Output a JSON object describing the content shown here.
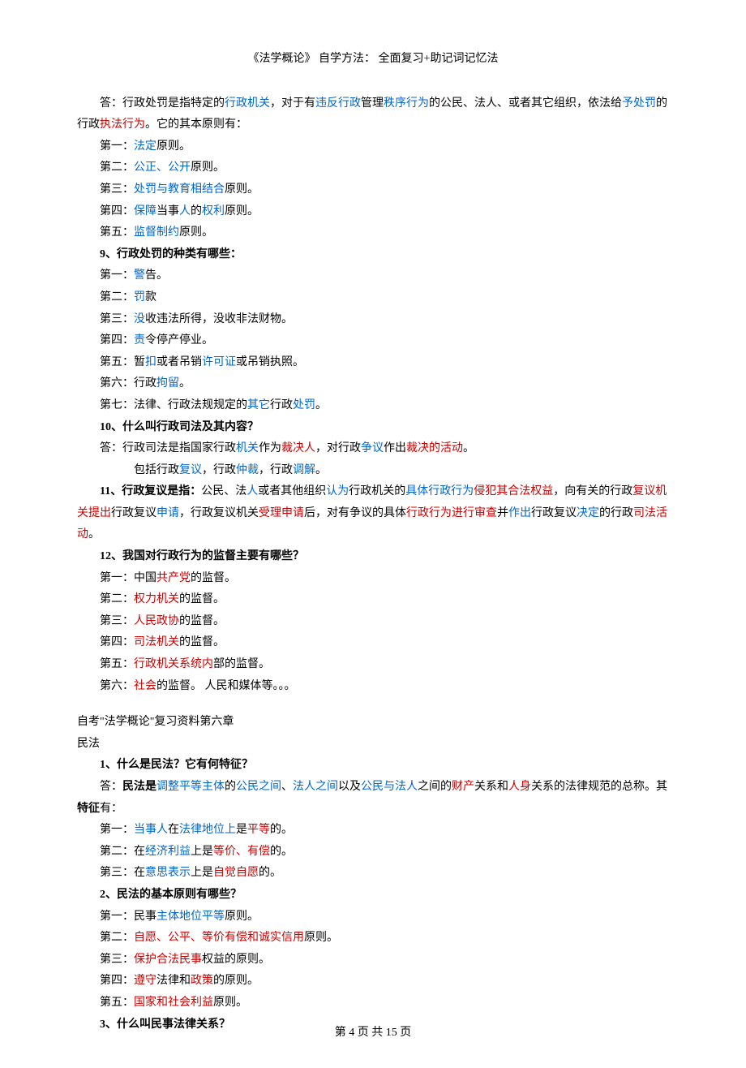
{
  "header": "《法学概论》 自学方法：   全面复习+助记词记忆法",
  "a_intro_p1": "答：行政处罚是指特定的",
  "a_intro_k1": "行政机关",
  "a_intro_p2": "，对于有",
  "a_intro_k2": "违反行政",
  "a_intro_p3": "管理",
  "a_intro_k3": "秩序行为",
  "a_intro_p4": "的公民、法人、或者其它组织，依法给",
  "a_intro_k4": "予处罚",
  "a_intro_p5": "的行政",
  "a_intro_k5": "执法行为",
  "a_intro_p6": "。它的其本原则有：",
  "p1_a": "第一：",
  "p1_b": "法定",
  "p1_c": "原则。",
  "p2_a": "第二：",
  "p2_b": "公正、公开",
  "p2_c": "原则。",
  "p3_a": "第三：",
  "p3_b": "处罚与教育相结合",
  "p3_c": "原则。",
  "p4_a": "第四：",
  "p4_b": "保障",
  "p4_c": "当事",
  "p4_d": "人",
  "p4_e": "的",
  "p4_f": "权利",
  "p4_g": "原则。",
  "p5_a": "第五：",
  "p5_b": "监督制约",
  "p5_c": "原则。",
  "q9": "9、行政处罚的种类有哪些：",
  "q9_1a": "第一：",
  "q9_1b": "警",
  "q9_1c": "告。",
  "q9_2a": "第二：",
  "q9_2b": "罚",
  "q9_2c": "款",
  "q9_3a": "第三：",
  "q9_3b": "没",
  "q9_3c": "收违法所得，没收非法财物。",
  "q9_4a": "第四：",
  "q9_4b": "责",
  "q9_4c": "令停产停业。",
  "q9_5a": "第五：暂",
  "q9_5b": "扣",
  "q9_5c": "或者吊销",
  "q9_5d": "许可证",
  "q9_5e": "或吊销执照。",
  "q9_6a": "第六：行政",
  "q9_6b": "拘留",
  "q9_6c": "。",
  "q9_7a": "第七：法律、行政法规规定的",
  "q9_7b": "其它",
  "q9_7c": "行政",
  "q9_7d": "处罚",
  "q9_7e": "。",
  "q10": "10、什么叫行政司法及其内容？",
  "q10_a1": "答：行政司法是指国家行政",
  "q10_a2": "机关",
  "q10_a3": "作为",
  "q10_a4": "裁决人",
  "q10_a5": "，对行政",
  "q10_a6": "争议",
  "q10_a7": "作出",
  "q10_a8": "裁决的活动",
  "q10_a9": "。",
  "q10_b1": "包括行政",
  "q10_b2": "复议",
  "q10_b3": "，行政",
  "q10_b4": "仲裁",
  "q10_b5": "，行政",
  "q10_b6": "调解",
  "q10_b7": "。",
  "q11a": "11、行政复议是指：",
  "q11b": "公民、法",
  "q11c": "人",
  "q11d": "或者其他组织",
  "q11e": "认为",
  "q11f": "行政机关的",
  "q11g": "具体行政行为",
  "q11h": "侵犯其合法权益",
  "q11i": "，向有关的行政",
  "q11j": "复议机关提出",
  "q11k": "行政复议",
  "q11l": "申请",
  "q11m": "，行政复议机关",
  "q11n": "受理申请",
  "q11o": "后，对有争议的具体",
  "q11p": "行政行为进行审查",
  "q11q": "并",
  "q11r": "作出",
  "q11s": "行政复议",
  "q11t": "决定",
  "q11u": "的行政",
  "q11v": "司法活动",
  "q11w": "。",
  "q12": "12、我国对行政行为的监督主要有哪些？",
  "q12_1a": "第一：中国",
  "q12_1b": "共产党",
  "q12_1c": "的监督。",
  "q12_2a": "第二：",
  "q12_2b": "权力机关",
  "q12_2c": "的监督。",
  "q12_3a": "第三：",
  "q12_3b": "人民政协",
  "q12_3c": "的监督。",
  "q12_4a": "第四：",
  "q12_4b": "司法机关",
  "q12_4c": "的监督。",
  "q12_5a": "第五：",
  "q12_5b": "行政机关系统内",
  "q12_5c": "部的监督。",
  "q12_6a": "第六：",
  "q12_6b": "社会",
  "q12_6c": "的监督。   人民和媒体等。。。",
  "ch6_title": "自考\"法学概论\"复习资料第六章",
  "ch6_sub": "民法",
  "m1": "1、什么是民法？它有何特征？",
  "m1_a": "答：",
  "m1_b": "民法是",
  "m1_c": "调整平等主体",
  "m1_d": "的",
  "m1_e": "公民之间",
  "m1_f": "、",
  "m1_g": "法人之间",
  "m1_h": "以及",
  "m1_i": "公民与法人",
  "m1_j": "之间的",
  "m1_k": "财产",
  "m1_l": "关系和",
  "m1_m": "人身",
  "m1_n": "关系的法律规范的总称。其",
  "m1_o": "特征",
  "m1_p": "有：",
  "m1_1a": "第一：",
  "m1_1b": "当事人",
  "m1_1c": "在",
  "m1_1d": "法律地位上",
  "m1_1e": "是",
  "m1_1f": "平等",
  "m1_1g": "的。",
  "m1_2a": "第二：在",
  "m1_2b": "经济利益",
  "m1_2c": "上是",
  "m1_2d": "等价、有偿",
  "m1_2e": "的。",
  "m1_3a": "第三：在",
  "m1_3b": "意思表示",
  "m1_3c": "上是",
  "m1_3d": "自觉自愿",
  "m1_3e": "的。",
  "m2": "2、民法的基本原则有哪些？",
  "m2_1a": "第一：民事",
  "m2_1b": "主体地位平等",
  "m2_1c": "原则。",
  "m2_2a": "第二：",
  "m2_2b": "自愿、公平、等价有偿和诚实信用",
  "m2_2c": "原则。",
  "m2_3a": "第三：",
  "m2_3b": "保护合法民事",
  "m2_3c": "权益的原则。",
  "m2_4a": "第四：",
  "m2_4b": "遵守",
  "m2_4c": "法律和",
  "m2_4d": "政策",
  "m2_4e": "的原则。",
  "m2_5a": "第五：",
  "m2_5b": "国家和社会利益",
  "m2_5c": "原则。",
  "m3": "3、什么叫民事法律关系？",
  "footer": "第 4 页 共 15 页"
}
